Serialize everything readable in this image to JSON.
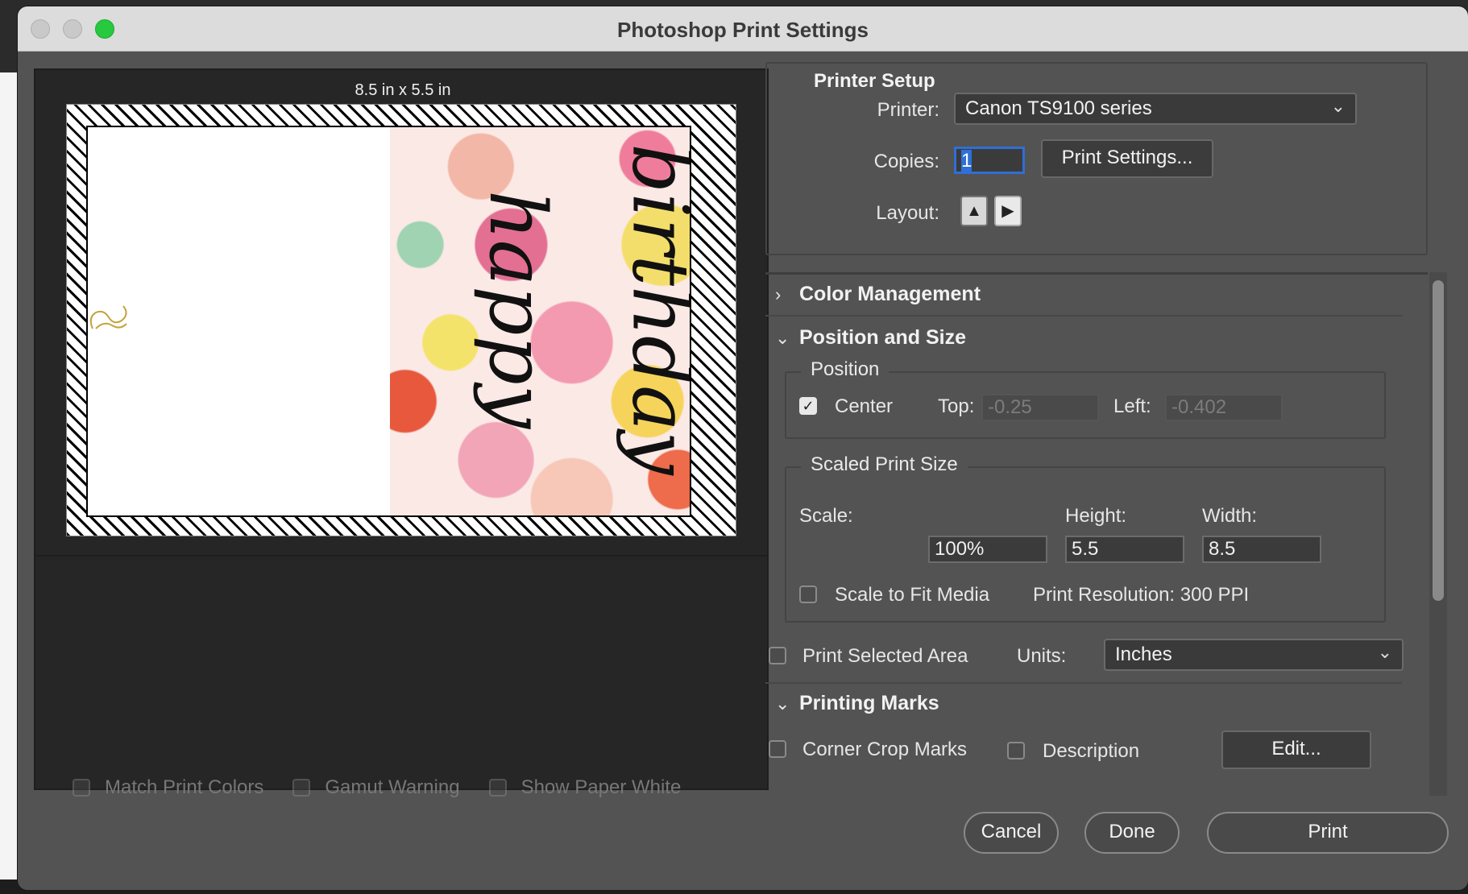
{
  "window": {
    "title": "Photoshop Print Settings"
  },
  "preview": {
    "paper_size": "8.5 in x 5.5 in",
    "artwork_text": [
      "happy",
      "birthday"
    ],
    "options": [
      {
        "label": "Match Print Colors",
        "checked": false
      },
      {
        "label": "Gamut Warning",
        "checked": false
      },
      {
        "label": "Show Paper White",
        "checked": false
      }
    ]
  },
  "printer_setup": {
    "title": "Printer Setup",
    "printer_label": "Printer:",
    "printer_value": "Canon TS9100 series",
    "copies_label": "Copies:",
    "copies_value": "1",
    "print_settings_button": "Print Settings...",
    "layout_label": "Layout:",
    "layout_icons": [
      "portrait-layout-icon",
      "landscape-layout-icon"
    ]
  },
  "color_management": {
    "title": "Color Management",
    "expanded": false
  },
  "position_and_size": {
    "title": "Position and Size",
    "expanded": true,
    "position": {
      "legend": "Position",
      "center_label": "Center",
      "center_checked": true,
      "top_label": "Top:",
      "top_value": "-0.25",
      "left_label": "Left:",
      "left_value": "-0.402"
    },
    "scaled": {
      "legend": "Scaled Print Size",
      "scale_label": "Scale:",
      "scale_value": "100%",
      "height_label": "Height:",
      "height_value": "5.5",
      "width_label": "Width:",
      "width_value": "8.5",
      "fit_label": "Scale to Fit Media",
      "fit_checked": false,
      "resolution": "Print Resolution: 300 PPI"
    },
    "print_selected_label": "Print Selected Area",
    "print_selected_checked": false,
    "units_label": "Units:",
    "units_value": "Inches"
  },
  "printing_marks": {
    "title": "Printing Marks",
    "expanded": true,
    "corner_crop_label": "Corner Crop Marks",
    "corner_crop_checked": false,
    "description_label": "Description",
    "description_checked": false,
    "edit_button": "Edit..."
  },
  "buttons": {
    "cancel": "Cancel",
    "done": "Done",
    "print": "Print"
  },
  "colors": {
    "accent": "#2f6fd6",
    "zoom": "#27c93f",
    "panel": "#535353"
  }
}
